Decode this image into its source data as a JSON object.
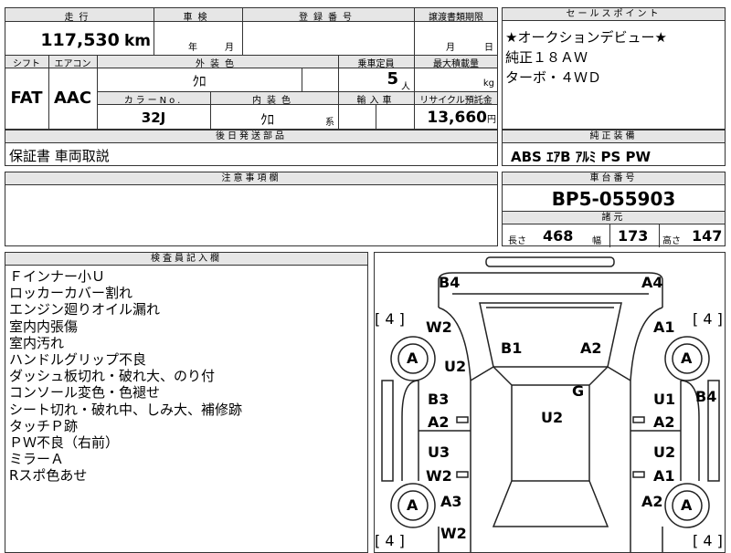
{
  "top": {
    "mileage_header": "走行",
    "mileage_value": "117,530",
    "mileage_unit": "km",
    "inspection_header": "車検",
    "inspection_year": "年",
    "inspection_month": "月",
    "registration_header": "登録番号",
    "transfer_header": "譲渡書類期限",
    "transfer_month": "月",
    "transfer_day": "日",
    "shift_header": "シフト",
    "aircon_header": "エアコン",
    "shift_value": "FAT",
    "aircon_value": "AAC",
    "exterior_header": "外装色",
    "exterior_value": "ｸﾛ",
    "capacity_header": "乗車定員",
    "capacity_value": "5",
    "capacity_unit": "人",
    "load_header": "最大積載量",
    "load_unit": "kg",
    "color_no_header": "カラーNo.",
    "color_no_value": "32J",
    "interior_header": "内装色",
    "interior_value": "ｸﾛ",
    "interior_unit": "系",
    "import_header": "輸入車",
    "recycle_header": "リサイクル預託金",
    "recycle_value": "13,660",
    "recycle_unit": "円"
  },
  "sales_point": {
    "header": "セールスポイント",
    "lines": [
      "★オークションデビュー★",
      "純正１８ＡＷ",
      "ターボ・４ＷＤ"
    ]
  },
  "later_parts": {
    "header": "後日発送部品",
    "value": "保証書 車両取説"
  },
  "equipment": {
    "header": "純正装備",
    "value": "ABS ｴｱB ｱﾙﾐ PS PW"
  },
  "notes": {
    "header": "注意事項欄"
  },
  "chassis": {
    "header": "車台番号",
    "value": "BP5-055903",
    "dims_header": "諸元",
    "length_label": "長さ",
    "length_value": "468",
    "width_label": "幅",
    "width_value": "173",
    "height_label": "高さ",
    "height_value": "147"
  },
  "inspector": {
    "header": "検査員記入欄",
    "items": [
      "Ｆインナー小Ｕ",
      "ロッカーカバー割れ",
      "エンジン廻りオイル漏れ",
      "室内内張傷",
      "室内汚れ",
      "ハンドルグリップ不良",
      "ダッシュ板切れ・破れ大、のり付",
      "コンソール変色・色褪せ",
      "シート切れ・破れ中、しみ大、補修跡",
      "タッチＰ跡",
      "ＰＷ不良（右前）",
      "ミラーＡ",
      "Rスポ色あせ"
    ]
  },
  "diagram": {
    "marks": [
      "B4",
      "A4",
      "W2",
      "A1",
      "B1",
      "A2",
      "U2",
      "G",
      "B3",
      "A2",
      "U1",
      "A2",
      "B4",
      "U2",
      "U3",
      "W2",
      "U2",
      "A1",
      "A3",
      "A2",
      "W2"
    ],
    "tire_labels": [
      "A",
      "A",
      "A",
      "A"
    ],
    "brackets": [
      "[ 4 ]",
      "[ 4 ]",
      "[ 4 ]",
      "[ 4 ]"
    ]
  }
}
